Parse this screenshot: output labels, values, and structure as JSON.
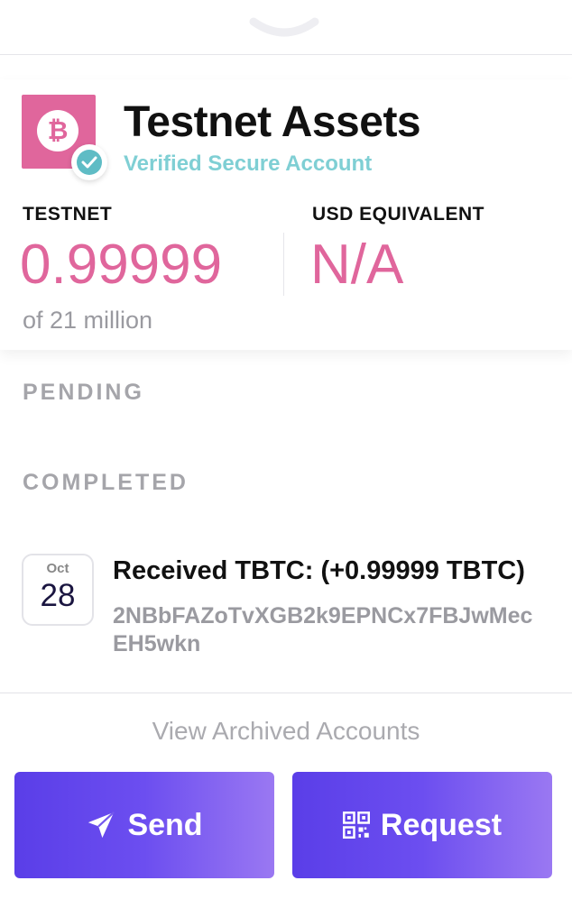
{
  "account": {
    "title": "Testnet Assets",
    "subtitle": "Verified Secure Account",
    "coin_symbol": "₿",
    "coin_color": "#e0669c",
    "verified_color": "#5fbcc5"
  },
  "balances": {
    "left_label": "TESTNET",
    "left_value": "0.99999",
    "right_label": "USD EQUIVALENT",
    "right_value": "N/A",
    "supply_note": "of 21 million"
  },
  "sections": {
    "pending": "PENDING",
    "completed": "COMPLETED"
  },
  "transactions": [
    {
      "month": "Oct",
      "day": "28",
      "title": "Received TBTC: (+0.99999 TBTC)",
      "address": "2NBbFAZoTvXGB2k9EPNCx7FBJwMecEH5wkn"
    }
  ],
  "footer": {
    "archived_link": "View Archived Accounts",
    "send_label": "Send",
    "request_label": "Request"
  },
  "icons": {
    "chevron": "chevron-down-icon",
    "send": "paper-plane-icon",
    "request": "qr-code-icon",
    "verified": "check-circle-icon"
  }
}
